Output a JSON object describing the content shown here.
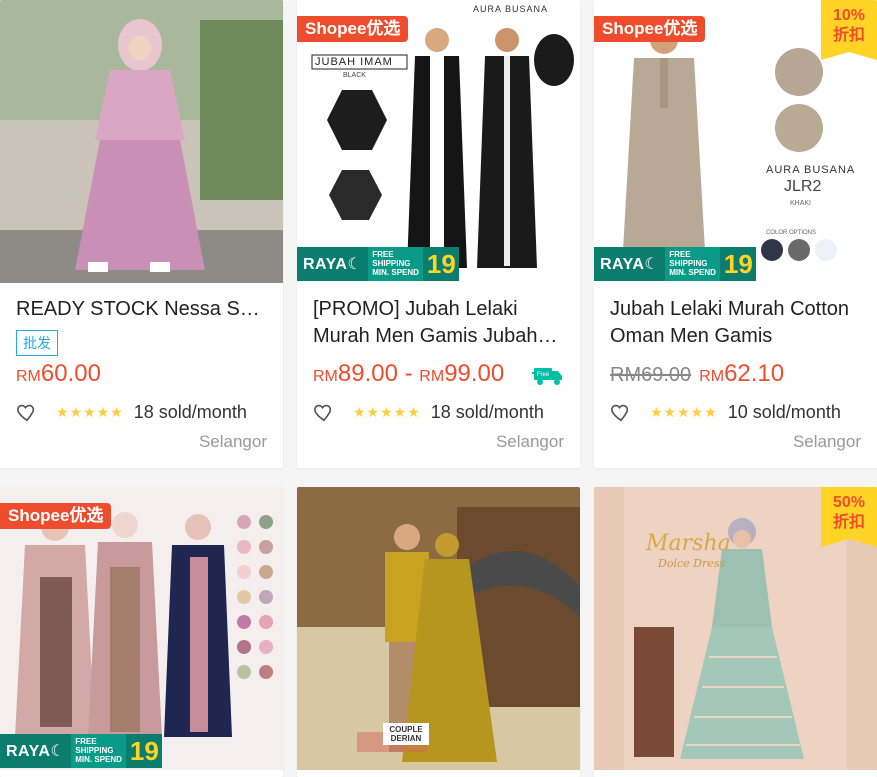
{
  "products": [
    {
      "title": "READY STOCK Nessa Set Dress + Khimar",
      "badge": "批发",
      "price_currency": "RM",
      "price": "60.00",
      "stars": "★★★★★",
      "sold": "18 sold/month",
      "location": "Selangor"
    },
    {
      "tag": "Shopee优选",
      "title": "[PROMO] Jubah Lelaki Murah Men Gamis Jubah Imam",
      "price_currency": "RM",
      "price_min": "89.00",
      "price_sep": "-",
      "price_max_currency": "RM",
      "price_max": "99.00",
      "free_ship_label": "Free",
      "stars": "★★★★★",
      "sold": "18 sold/month",
      "location": "Selangor",
      "raya": {
        "brand": "RAYA☾",
        "line1": "FREE",
        "line2": "SHIPPING",
        "line3": "MIN. SPEND",
        "amount": "19"
      },
      "image_text": {
        "brand": "AURA BUSANA",
        "name": "JUBAH IMAM",
        "sub": "BLACK"
      }
    },
    {
      "tag": "Shopee优选",
      "discount_pct": "10%",
      "discount_label": "折扣",
      "title": "Jubah Lelaki Murah Cotton Oman Men Gamis",
      "old_currency": "RM",
      "old_price": "69.00",
      "price_currency": "RM",
      "price": "62.10",
      "stars": "★★★★★",
      "sold": "10 sold/month",
      "location": "Selangor",
      "raya": {
        "brand": "RAYA☾",
        "line1": "FREE",
        "line2": "SHIPPING",
        "line3": "MIN. SPEND",
        "amount": "19"
      },
      "image_text": {
        "brand": "AURA BUSANA",
        "name": "JLR2",
        "sub": "KHAKI",
        "options": "COLOR OPTIONS"
      }
    },
    {
      "tag": "Shopee优选",
      "raya": {
        "brand": "RAYA☾",
        "line1": "FREE",
        "line2": "SHIPPING",
        "line3": "MIN. SPEND",
        "amount": "19"
      }
    },
    {
      "image_text": {
        "caption": "COUPLE DERIAN"
      }
    },
    {
      "discount_pct": "50%",
      "discount_label": "折扣",
      "image_text": {
        "name": "Marsha",
        "sub": "Dolce Dress"
      }
    }
  ],
  "colors": {
    "brand": "#ee4d2d",
    "discount": "#ffd424",
    "star": "#ffce3d",
    "badge": "#26aae1",
    "raya": "#0b7d6f"
  },
  "icons": {
    "wishlist": "heart-outline-icon",
    "free_shipping": "truck-icon"
  }
}
